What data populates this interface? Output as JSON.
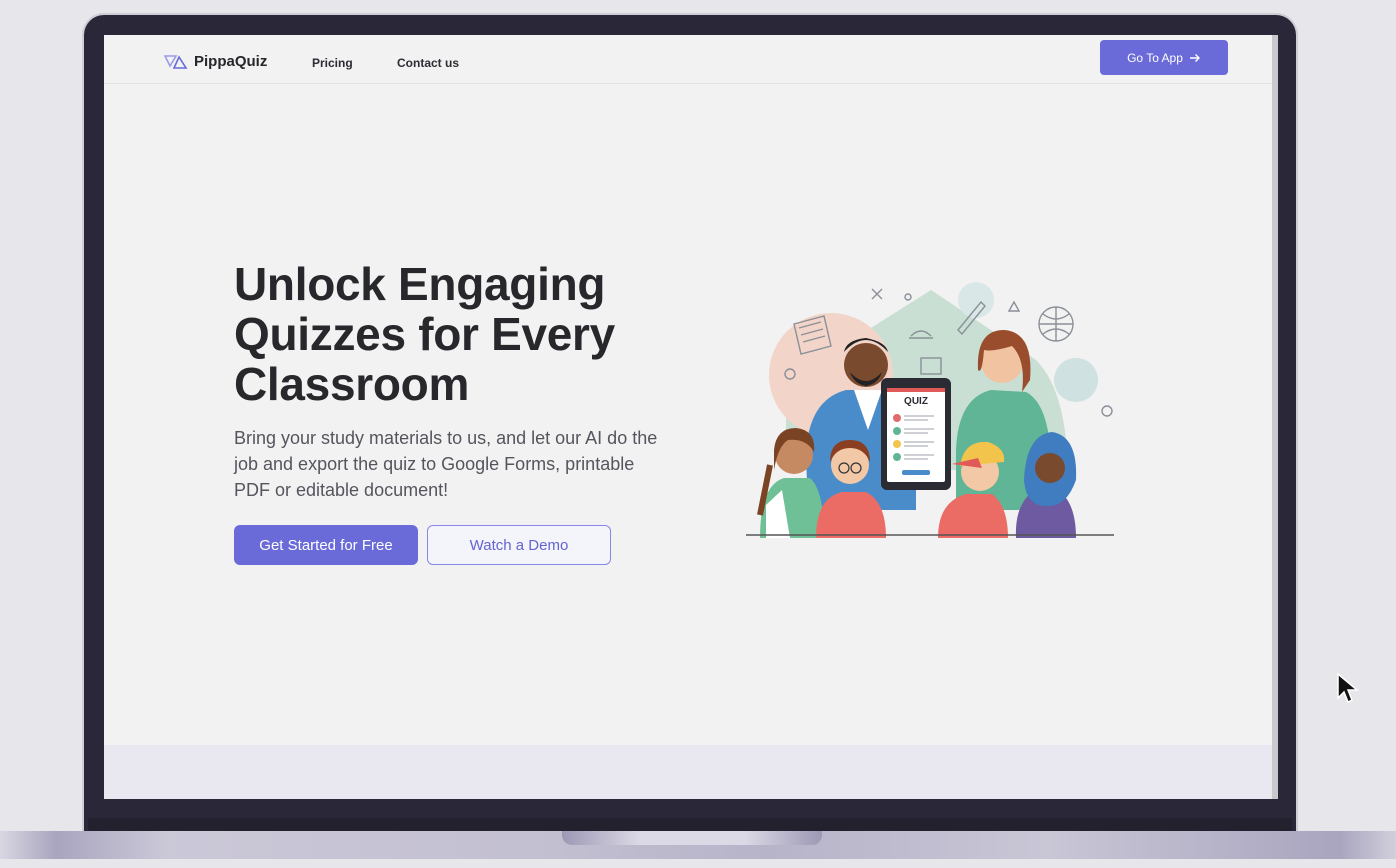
{
  "navbar": {
    "brand": "PippaQuiz",
    "links": [
      {
        "label": "Pricing"
      },
      {
        "label": "Contact us"
      }
    ],
    "cta_label": "Go To App",
    "cta_icon": "arrow-right-icon"
  },
  "hero": {
    "title": "Unlock Engaging Quizzes for Every Classroom",
    "subtitle": "Bring your study materials to us, and let  our AI do the job and export the quiz to Google Forms, printable PDF or editable document!",
    "primary_button": "Get Started for Free",
    "secondary_button": "Watch a Demo",
    "illustration_label": "QUIZ"
  },
  "colors": {
    "accent": "#6a6ad9",
    "heading": "#27272c",
    "body_text": "#55555e",
    "background": "#f2f2f2"
  }
}
